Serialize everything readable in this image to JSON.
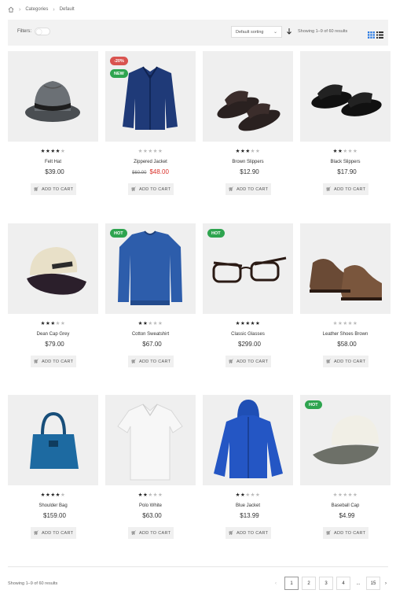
{
  "breadcrumb": {
    "items": [
      "Categories",
      "Default"
    ]
  },
  "toolbar": {
    "filters_label": "Filters:",
    "sort_value": "Default sorting",
    "showing": "Showing 1–9 of 60 results"
  },
  "products": [
    {
      "name": "Felt Hat",
      "price": "$39.00",
      "rating": 4,
      "badges": []
    },
    {
      "name": "Zippered Jacket",
      "old_price": "$60.00",
      "price": "$48.00",
      "rating": 0,
      "badges": [
        {
          "text": "-20%",
          "color": "#d9534f"
        },
        {
          "text": "NEW",
          "color": "#2ea44f"
        }
      ]
    },
    {
      "name": "Brown Slippers",
      "price": "$12.90",
      "rating": 3,
      "badges": []
    },
    {
      "name": "Black Slippers",
      "price": "$17.90",
      "rating": 2,
      "badges": []
    },
    {
      "name": "Dean Cap Grey",
      "price": "$79.00",
      "rating": 2.5,
      "badges": []
    },
    {
      "name": "Cotton Sweatshirt",
      "price": "$67.00",
      "rating": 2,
      "badges": [
        {
          "text": "HOT",
          "color": "#2ea44f"
        }
      ]
    },
    {
      "name": "Classic Glasses",
      "price": "$299.00",
      "rating": 5,
      "badges": [
        {
          "text": "HOT",
          "color": "#2ea44f"
        }
      ]
    },
    {
      "name": "Leather Shoes Brown",
      "price": "$58.00",
      "rating": 0,
      "badges": []
    },
    {
      "name": "Shoulder Bag",
      "price": "$159.00",
      "rating": 3.5,
      "badges": []
    },
    {
      "name": "Polo White",
      "price": "$63.00",
      "rating": 2,
      "badges": []
    },
    {
      "name": "Blue Jacket",
      "price": "$13.99",
      "rating": 2,
      "badges": []
    },
    {
      "name": "Baseball Cap",
      "price": "$4.99",
      "rating": 0,
      "badges": [
        {
          "text": "HOT",
          "color": "#2ea44f"
        }
      ]
    }
  ],
  "add_to_cart_label": "ADD TO CART",
  "footer": {
    "showing": "Showing 1–9 of 60 results"
  },
  "pagination": {
    "pages": [
      "1",
      "2",
      "3",
      "4",
      "...",
      "15"
    ],
    "current": "1"
  },
  "colors": {
    "accent": "#2a7ae2",
    "sale": "#d9312a",
    "hot": "#2ea44f"
  }
}
